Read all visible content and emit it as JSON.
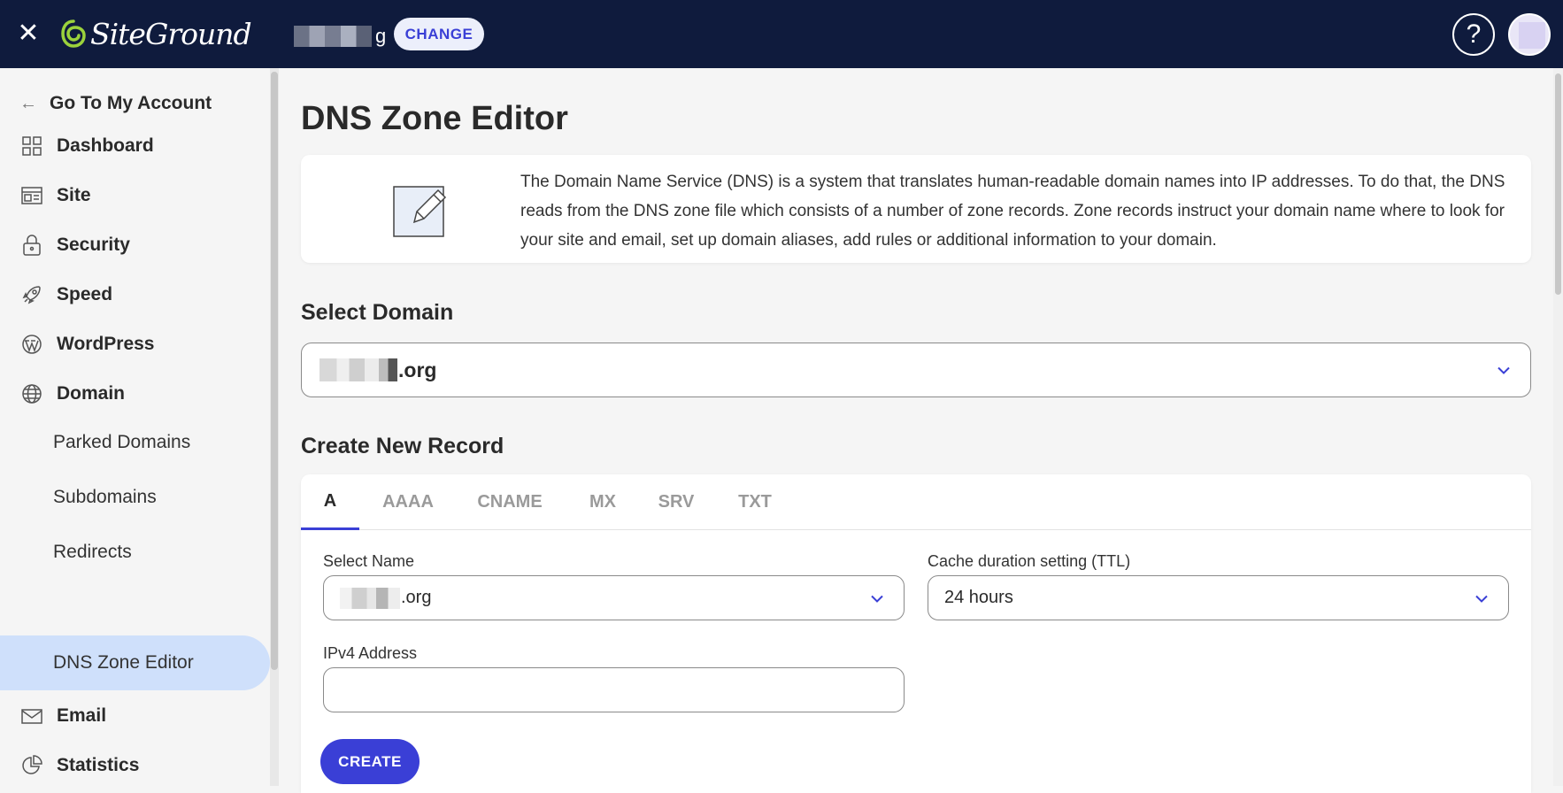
{
  "topbar": {
    "close_symbol": "✕",
    "logo_text": "SiteGround",
    "site_suffix": "g",
    "change_label": "CHANGE",
    "help_symbol": "?"
  },
  "sidebar": {
    "back_label": "Go To My Account",
    "items": [
      {
        "label": "Dashboard",
        "icon": "dashboard-icon"
      },
      {
        "label": "Site",
        "icon": "site-icon"
      },
      {
        "label": "Security",
        "icon": "lock-icon"
      },
      {
        "label": "Speed",
        "icon": "rocket-icon"
      },
      {
        "label": "WordPress",
        "icon": "wordpress-icon"
      },
      {
        "label": "Domain",
        "icon": "globe-icon"
      }
    ],
    "sub_items": [
      {
        "label": "Parked Domains"
      },
      {
        "label": "Subdomains"
      },
      {
        "label": "Redirects"
      },
      {
        "label": "DNS Zone Editor",
        "active": true
      }
    ],
    "more_items": [
      {
        "label": "Email",
        "icon": "mail-icon"
      },
      {
        "label": "Statistics",
        "icon": "pie-chart-icon"
      }
    ]
  },
  "main": {
    "title": "DNS Zone Editor",
    "info_text": "The Domain Name Service (DNS) is a system that translates human-readable domain names into IP addresses. To do that, the DNS reads from the DNS zone file which consists of a number of zone records. Zone records instruct your domain name where to look for your site and email, set up domain aliases, add rules or additional information to your domain.",
    "select_domain_label": "Select Domain",
    "selected_domain_suffix": ".org",
    "create_record_label": "Create New Record",
    "tabs": [
      {
        "label": "A",
        "active": true
      },
      {
        "label": "AAAA"
      },
      {
        "label": "CNAME"
      },
      {
        "label": "MX"
      },
      {
        "label": "SRV"
      },
      {
        "label": "TXT"
      }
    ],
    "select_name_label": "Select Name",
    "select_name_suffix": ".org",
    "ttl_label": "Cache duration setting (TTL)",
    "ttl_value": "24 hours",
    "ipv4_label": "IPv4 Address",
    "ipv4_value": "",
    "create_label": "CREATE"
  },
  "colors": {
    "topbar_bg": "#0f1b3d",
    "accent": "#3a3fd6",
    "active_nav_bg": "#cfe0fb",
    "logo_green": "#9bd23c"
  }
}
